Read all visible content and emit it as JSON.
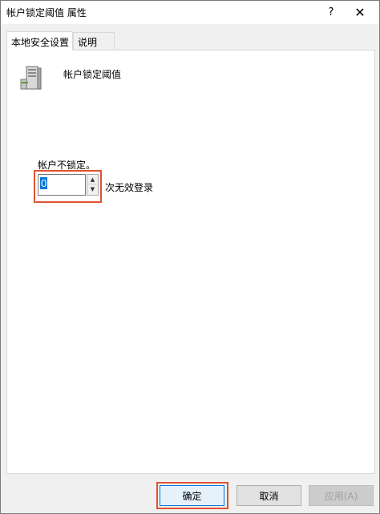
{
  "window": {
    "title": "帐户锁定阈值 属性",
    "help_label": "?",
    "close_label": "✕"
  },
  "tabs": [
    {
      "label": "本地安全设置",
      "active": true
    },
    {
      "label": "说明",
      "active": false
    }
  ],
  "policy": {
    "icon": "server-policy-icon",
    "name": "帐户锁定阈值"
  },
  "setting": {
    "status": "帐户不锁定。",
    "value": "0",
    "unit": "次无效登录",
    "up_icon": "▲",
    "down_icon": "▼"
  },
  "buttons": {
    "ok": "确定",
    "cancel": "取消",
    "apply": "应用(A)"
  },
  "colors": {
    "highlight": "#e0522f",
    "selection": "#0078d7"
  }
}
